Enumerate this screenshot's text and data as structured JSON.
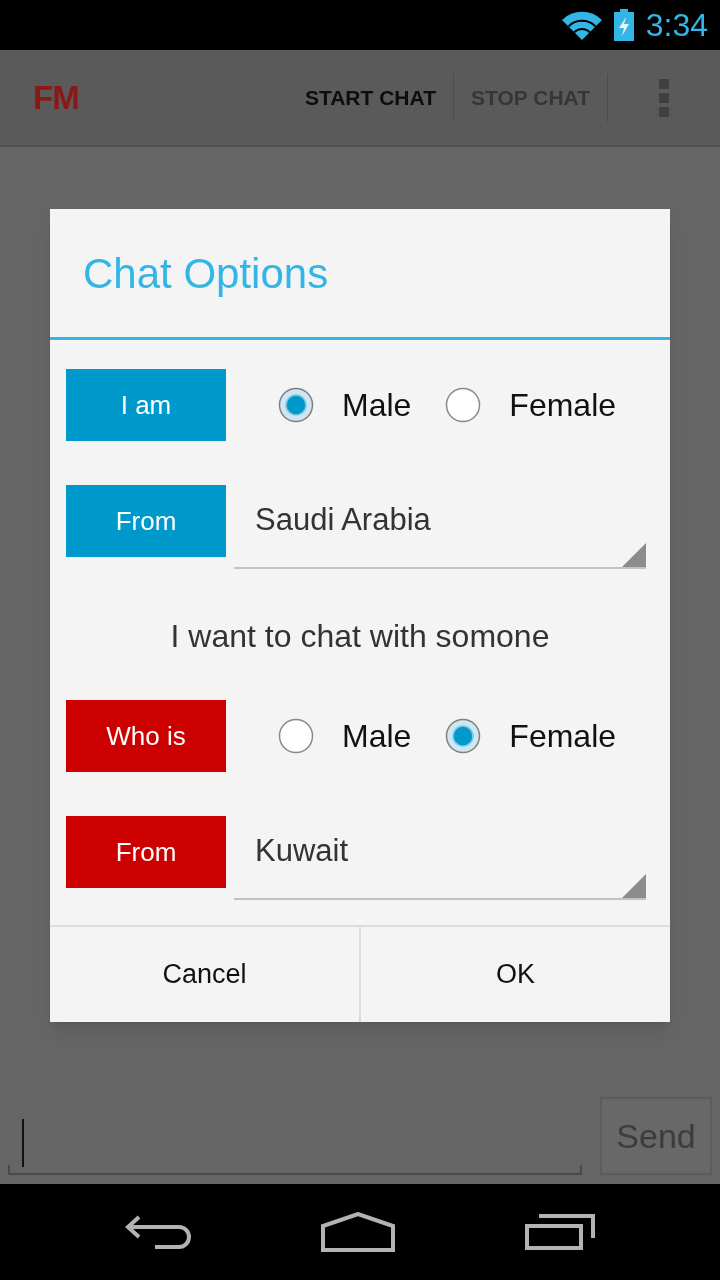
{
  "status_bar": {
    "time": "3:34"
  },
  "action_bar": {
    "logo": "FM",
    "actions": [
      {
        "label": "START CHAT",
        "disabled": false
      },
      {
        "label": "STOP CHAT",
        "disabled": true
      }
    ]
  },
  "dialog": {
    "title": "Chat Options",
    "rows": [
      {
        "kind": "radio",
        "label": "I am",
        "color": "#0099cc",
        "options": [
          {
            "label": "Male",
            "selected": true
          },
          {
            "label": "Female",
            "selected": false
          }
        ]
      },
      {
        "kind": "spinner",
        "label": "From",
        "color": "#0099cc",
        "value": "Saudi Arabia"
      },
      {
        "kind": "text",
        "text": "I want to chat with somone"
      },
      {
        "kind": "radio",
        "label": "Who is",
        "color": "#cc0000",
        "options": [
          {
            "label": "Male",
            "selected": false
          },
          {
            "label": "Female",
            "selected": true
          }
        ]
      },
      {
        "kind": "spinner",
        "label": "From",
        "color": "#cc0000",
        "value": "Kuwait"
      }
    ],
    "buttons": [
      "Cancel",
      "OK"
    ]
  },
  "composer": {
    "send_button": {
      "label": "Send",
      "disabled": true
    }
  }
}
